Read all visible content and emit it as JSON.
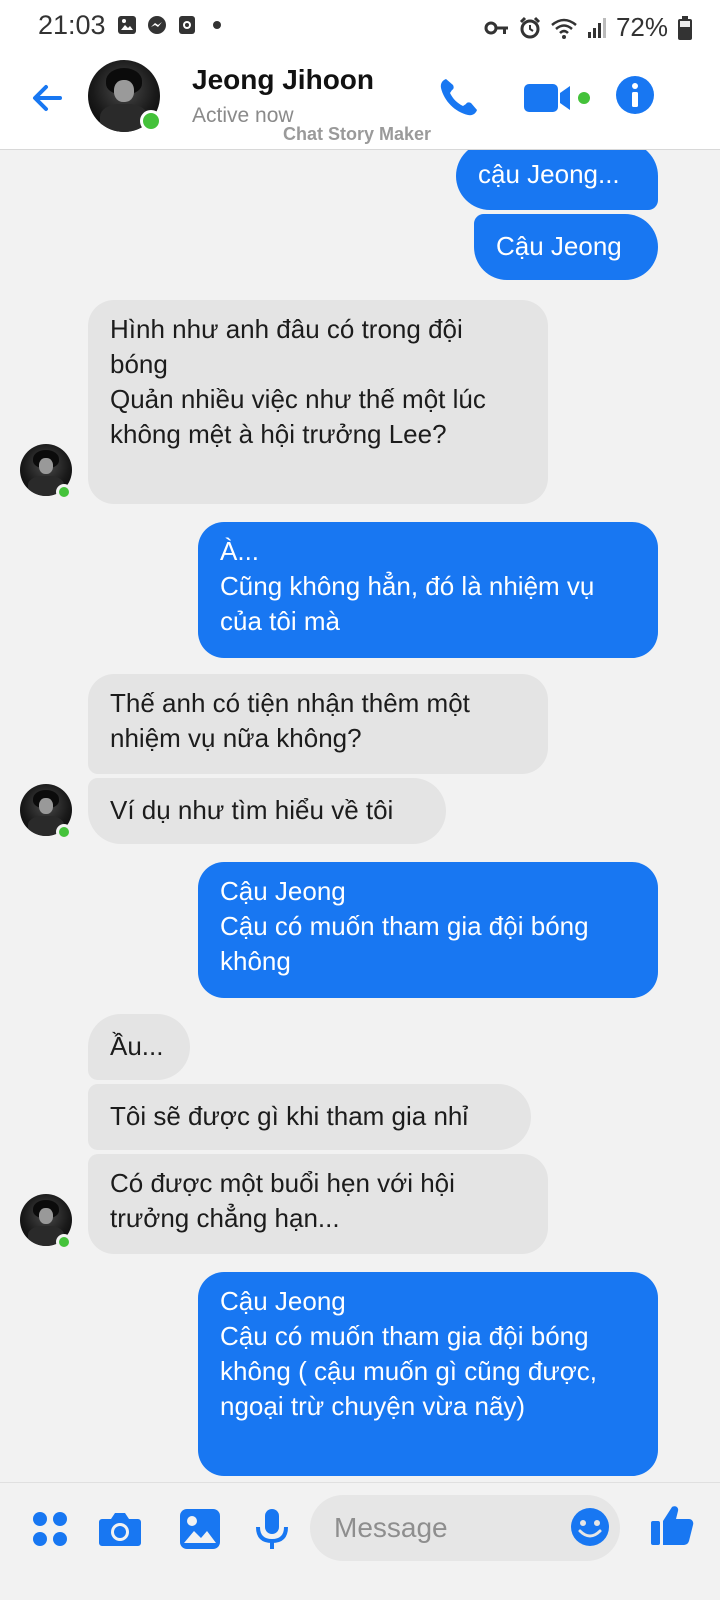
{
  "status_bar": {
    "time": "21:03",
    "battery": "72%",
    "left_icons": [
      "gallery-icon",
      "messenger-icon",
      "media-icon",
      "dot-icon"
    ],
    "right_icons": [
      "key-icon",
      "alarm-icon",
      "wifi-icon",
      "signal-icon",
      "battery-icon"
    ]
  },
  "header": {
    "contact_name": "Jeong Jihoon",
    "active_status": "Active now",
    "watermark": "Chat Story Maker",
    "icons": [
      "back-arrow-icon",
      "phone-icon",
      "video-camera-icon",
      "info-icon"
    ],
    "accent_color": "#1877f2",
    "online_color": "#44c23a"
  },
  "messages": [
    {
      "side": "out",
      "text": "cậu Jeong..."
    },
    {
      "side": "out",
      "text": "Cậu Jeong"
    },
    {
      "side": "in",
      "text": "Hình như anh đâu có trong đội bóng\nQuản nhiều việc như thế một lúc không mệt à hội trưởng Lee?"
    },
    {
      "side": "out",
      "text": "À...\nCũng không hẳn, đó là nhiệm vụ của tôi mà"
    },
    {
      "side": "in",
      "text": "Thế anh có tiện nhận thêm một nhiệm vụ nữa không?"
    },
    {
      "side": "in",
      "text": "Ví dụ như tìm hiểu về tôi"
    },
    {
      "side": "out",
      "text": "Cậu Jeong\nCậu có muốn tham gia đội bóng không"
    },
    {
      "side": "in",
      "text": "Ầu..."
    },
    {
      "side": "in",
      "text": "Tôi sẽ được gì khi tham gia nhỉ"
    },
    {
      "side": "in",
      "text": "Có được một buổi hẹn với hội trưởng chẳng hạn..."
    },
    {
      "side": "out",
      "text": "Cậu Jeong\nCậu có muốn tham gia đội bóng không ( cậu muốn gì cũng được, ngoại trừ chuyện vừa nãy)"
    }
  ],
  "composer": {
    "placeholder": "Message",
    "icons": [
      "menu-dots-icon",
      "camera-icon",
      "gallery-icon",
      "microphone-icon",
      "emoji-icon",
      "thumbs-up-icon"
    ]
  }
}
